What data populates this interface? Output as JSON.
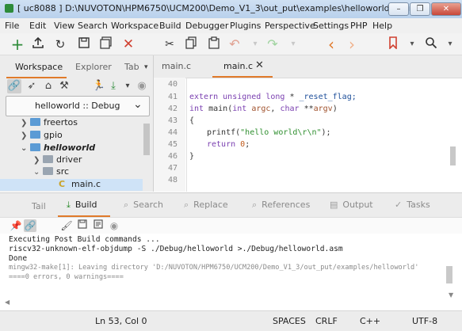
{
  "window": {
    "title": "[ uc8088 ] D:\\NUVOTON\\HPM6750\\UCM200\\Demo_V1_3\\out_put\\examples\\helloworld\\main.c",
    "buttons": [
      "–",
      "❐",
      "✕"
    ]
  },
  "menu": [
    "File",
    "Edit",
    "View",
    "Search",
    "Workspace",
    "Build",
    "Debugger",
    "Plugins",
    "Perspective",
    "Settings",
    "PHP",
    "Help"
  ],
  "toolbar": {
    "icons": [
      "new-icon",
      "upload-icon",
      "reload-icon",
      "save-icon",
      "save-all-icon",
      "close-icon",
      "cut-icon",
      "copy-icon",
      "paste-icon",
      "undo-icon",
      "redo-icon",
      "back-icon",
      "forward-icon",
      "bookmark-icon",
      "find-icon",
      "find-dropdown-icon"
    ],
    "colors": {
      "accent": "#e07a2a",
      "green": "#2e8b3a",
      "red": "#d04030",
      "orange": "#e0782a"
    }
  },
  "left_panel": {
    "tabs": [
      "Workspace",
      "Explorer",
      "Tab"
    ],
    "project_select": "helloworld :: Debug",
    "tree": [
      {
        "label": "freertos",
        "type": "folder",
        "state": "collapsed"
      },
      {
        "label": "gpio",
        "type": "folder",
        "state": "collapsed"
      },
      {
        "label": "helloworld",
        "type": "project",
        "state": "expanded"
      },
      {
        "label": "driver",
        "type": "folder-gray",
        "state": "collapsed"
      },
      {
        "label": "src",
        "type": "folder-gray",
        "state": "expanded"
      },
      {
        "label": "main.c",
        "type": "c-file",
        "state": "selected"
      }
    ]
  },
  "editor": {
    "tabs": [
      "main.c",
      "main.c"
    ],
    "active_tab_index": 1,
    "close_glyph": "✕",
    "line_numbers": [
      "40",
      "41",
      "42",
      "43",
      "44",
      "45",
      "46",
      "47",
      "48"
    ],
    "lines": {
      "l41_a": "extern ",
      "l41_b": "unsigned long",
      "l41_c": " * ",
      "l41_d": "_reset_flag;",
      "l42_a": "int ",
      "l42_b": "main",
      "l42_c": "(",
      "l42_d": "int ",
      "l42_e": "argc",
      "l42_f": ", ",
      "l42_g": "char",
      "l42_h": " **",
      "l42_i": "argv",
      "l42_j": ")",
      "l43": "{",
      "l44_a": "printf",
      "l44_b": "(",
      "l44_c": "\"hello world\\r\\n\"",
      "l44_d": ");",
      "l45_a": "return ",
      "l45_b": "0",
      "l45_c": ";",
      "l46": "}"
    }
  },
  "bottom_tabs": [
    "Tail",
    "Build",
    "Search",
    "Replace",
    "References",
    "Output",
    "Tasks"
  ],
  "output": {
    "lines": [
      "Executing Post Build commands ...",
      "riscv32-unknown-elf-objdump -S ./Debug/helloworld >./Debug/helloworld.asm",
      "Done",
      "mingw32-make[1]: Leaving directory 'D:/NUVOTON/HPM6750/UCM200/Demo_V1_3/out_put/examples/helloworld'",
      "====0 errors, 0 warnings===="
    ]
  },
  "status": {
    "position": "Ln 53, Col 0",
    "indent": "SPACES",
    "eol": "CRLF",
    "language": "C++",
    "encoding": "UTF-8"
  }
}
